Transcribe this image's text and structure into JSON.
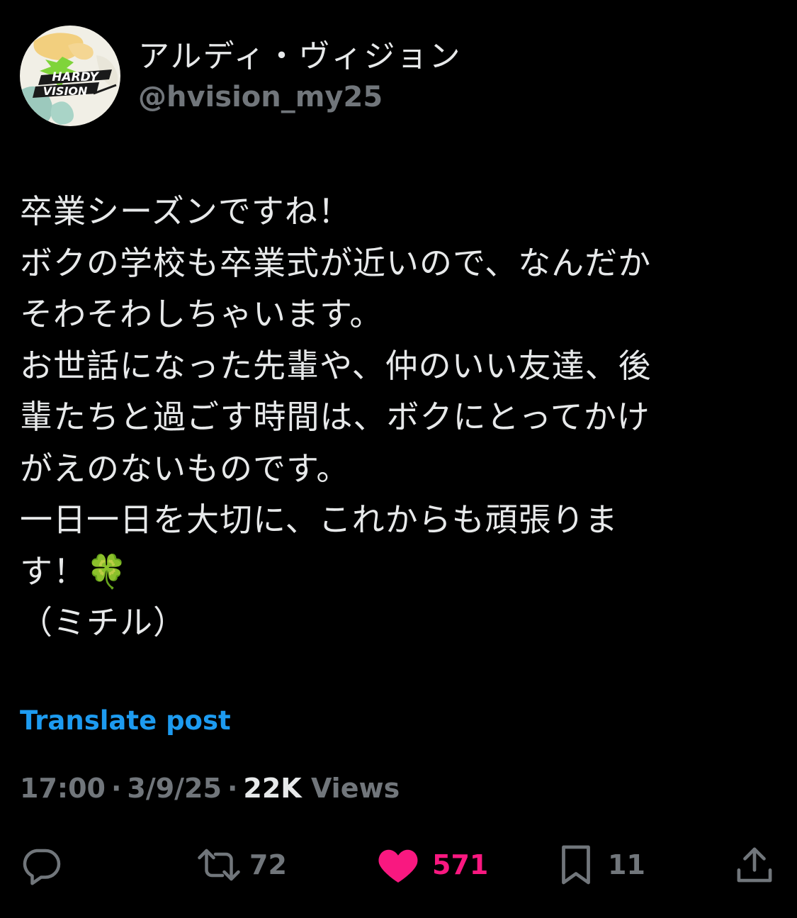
{
  "author": {
    "display_name": "アルディ・ヴィジョン",
    "handle": "@hvision_my25",
    "avatar_text_1": "HARDY",
    "avatar_text_2": "VISION"
  },
  "post": {
    "lines": [
      "卒業シーズンですね！",
      "ボクの学校も卒業式が近いので、なんだか",
      "そわそわしちゃいます。",
      "お世話になった先輩や、仲のいい友達、後",
      "輩たちと過ごす時間は、ボクにとってかけ",
      "がえのないものです。",
      "一日一日を大切に、これからも頑張りま",
      "す！🍀",
      "（ミチル）"
    ]
  },
  "translate_label": "Translate post",
  "meta": {
    "time": "17:00",
    "date": "3/9/25",
    "separator": "·",
    "views_count": "22K",
    "views_label": "Views"
  },
  "actions": {
    "reply_count": "",
    "retweet_count": "72",
    "like_count": "571",
    "bookmark_count": "11"
  },
  "colors": {
    "background": "#000000",
    "text": "#e7e9ea",
    "muted": "#71767b",
    "link": "#1d9bf0",
    "like": "#f91880"
  }
}
